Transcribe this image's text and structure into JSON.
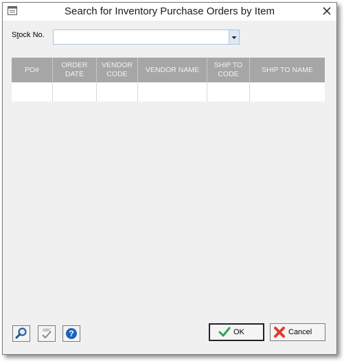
{
  "window": {
    "title": "Search for Inventory Purchase Orders by Item"
  },
  "stock": {
    "label_prefix": "S",
    "label_underline": "t",
    "label_rest": "ock No.",
    "value": ""
  },
  "grid": {
    "columns": [
      "PO#",
      "ORDER\nDATE",
      "VENDOR\nCODE",
      "VENDOR NAME",
      "SHIP TO\nCODE",
      "SHIP TO NAME"
    ],
    "rows": [
      [
        "",
        "",
        "",
        "",
        "",
        ""
      ]
    ]
  },
  "buttons": {
    "ok_label": "OK",
    "cancel_label": "Cancel"
  },
  "icons": {
    "window": "window-icon",
    "close": "close-icon",
    "search": "magnifier-icon",
    "spell": "spellcheck-icon",
    "help": "help-icon",
    "ok": "checkmark-icon",
    "cancel": "red-x-icon"
  },
  "colors": {
    "header_bg": "#a6a6a6",
    "help_blue": "#1f63b8",
    "ok_green": "#2fa35a",
    "cancel_red": "#e03a2f"
  }
}
